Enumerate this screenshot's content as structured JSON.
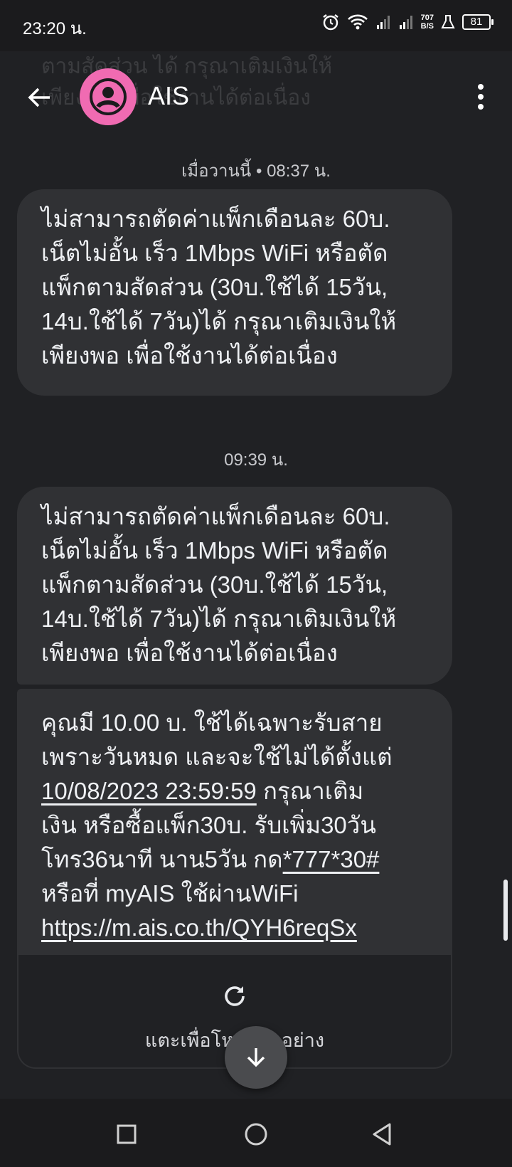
{
  "status_bar": {
    "time": "23:20 น.",
    "net_speed_value": "707",
    "net_speed_unit": "B/S",
    "battery": "81",
    "icons": [
      "alarm-icon",
      "wifi-icon",
      "signal-icon",
      "signal-icon",
      "lab-icon",
      "battery-icon"
    ]
  },
  "header": {
    "contact_name": "AIS",
    "avatar_color": "#f06bb2",
    "scrolled_text_line1": "ตามสัดส่วน ได้ กรุณาเติมเงินให้",
    "scrolled_text_line2": "เพียงพอ เพื่อใช้งานได้ต่อเนื่อง",
    "icons": [
      "back-arrow-icon",
      "person-icon",
      "more-vert-icon"
    ]
  },
  "thread": {
    "timestamp_1": "เมื่อวานนี้ • 08:37 น.",
    "message_1": {
      "lines": [
        "ไม่สามารถตัดค่าแพ็กเดือนละ 60บ.",
        "เน็ตไม่อั้น เร็ว 1Mbps WiFi หรือตัด",
        "แพ็กตามสัดส่วน (30บ.ใช้ได้ 15วัน,",
        "14บ.ใช้ได้ 7วัน)ได้ กรุณาเติมเงินให้",
        "เพียงพอ เพื่อใช้งานได้ต่อเนื่อง"
      ]
    },
    "timestamp_2": "09:39 น.",
    "message_2": {
      "lines": [
        "ไม่สามารถตัดค่าแพ็กเดือนละ 60บ.",
        "เน็ตไม่อั้น เร็ว 1Mbps WiFi หรือตัด",
        "แพ็กตามสัดส่วน (30บ.ใช้ได้ 15วัน,",
        "14บ.ใช้ได้ 7วัน)ได้ กรุณาเติมเงินให้",
        "เพียงพอ เพื่อใช้งานได้ต่อเนื่อง"
      ]
    },
    "message_3": {
      "line1": "คุณมี 10.00 บ. ใช้ได้เฉพาะรับสาย",
      "line2": "เพราะวันหมด และจะใช้ไม่ได้ตั้งแต่",
      "date_link": "10/08/2023 23:59:59",
      "line3_suffix": " กรุณาเติม",
      "line4": "เงิน หรือซื้อแพ็ก30บ. รับเพิ่ม30วัน",
      "line5_prefix": "โทร36นาที นาน5วัน กด",
      "ussd_link": "*777*30#",
      "line6": "หรือที่ myAIS ใช้ผ่านWiFi",
      "url_link": "https://m.ais.co.th/QYH6reqSx"
    },
    "retry_label": "แตะเพื่อโหลดตัวอย่าง"
  },
  "nav_bar": {
    "icons": [
      "recents-square-icon",
      "home-circle-icon",
      "back-triangle-icon"
    ]
  }
}
